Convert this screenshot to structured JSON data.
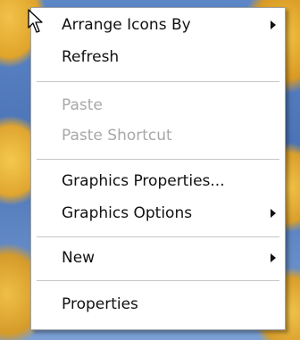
{
  "menu": {
    "items": [
      {
        "label": "Arrange Icons By",
        "enabled": true,
        "submenu": true
      },
      {
        "label": "Refresh",
        "enabled": true,
        "submenu": false
      },
      {
        "label": "Paste",
        "enabled": false,
        "submenu": false
      },
      {
        "label": "Paste Shortcut",
        "enabled": false,
        "submenu": false
      },
      {
        "label": "Graphics Properties...",
        "enabled": true,
        "submenu": false
      },
      {
        "label": "Graphics Options",
        "enabled": true,
        "submenu": true
      },
      {
        "label": "New",
        "enabled": true,
        "submenu": true
      },
      {
        "label": "Properties",
        "enabled": true,
        "submenu": false
      }
    ]
  },
  "colors": {
    "menu_background": "#ffffff",
    "text": "#111111",
    "disabled_text": "#a8a8a8",
    "separator": "#c6c6c6"
  },
  "icons": {
    "cursor": "arrow-cursor-icon",
    "submenu": "submenu-arrow-icon"
  }
}
